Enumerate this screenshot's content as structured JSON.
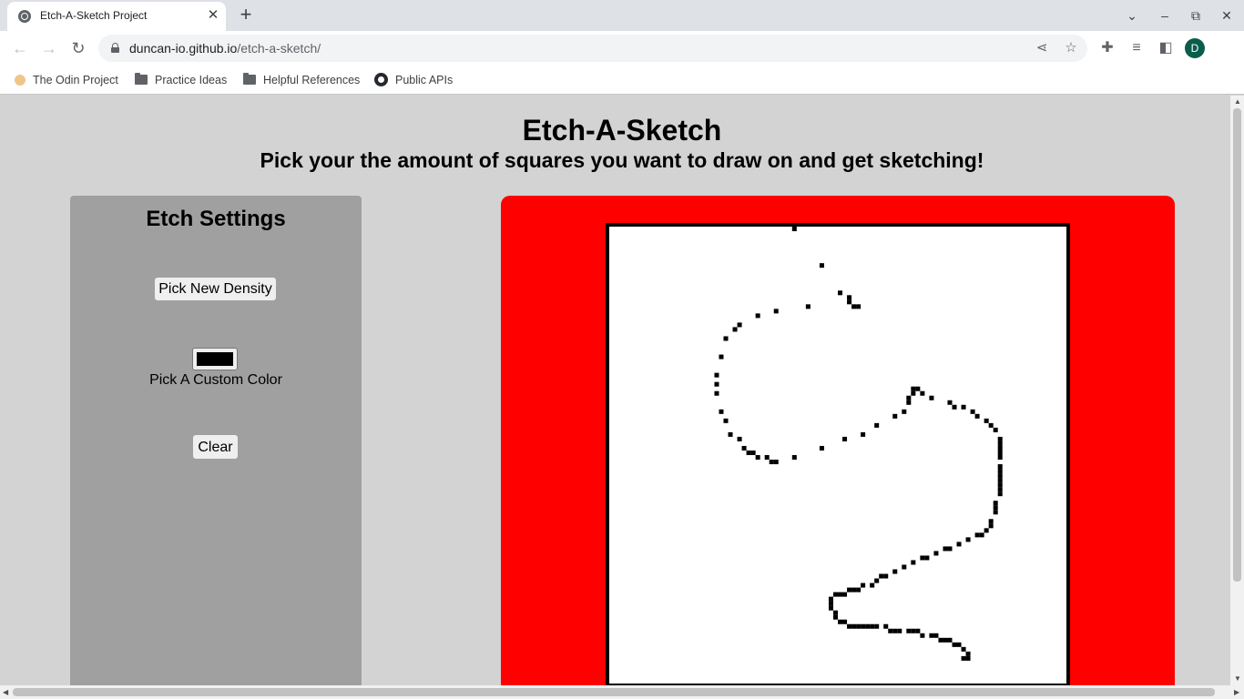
{
  "browser": {
    "tab_title": "Etch-A-Sketch Project",
    "url_host": "duncan-io.github.io",
    "url_path": "/etch-a-sketch/",
    "profile_initial": "D",
    "bookmarks": [
      {
        "label": "The Odin Project",
        "icon": "odin-icon"
      },
      {
        "label": "Practice Ideas",
        "icon": "folder-icon"
      },
      {
        "label": "Helpful References",
        "icon": "folder-icon"
      },
      {
        "label": "Public APIs",
        "icon": "github-icon"
      }
    ]
  },
  "page": {
    "title": "Etch-A-Sketch",
    "subtitle": "Pick your the amount of squares you want to draw on and get sketching!"
  },
  "settings": {
    "title": "Etch Settings",
    "density_button": "Pick New Density",
    "color_label": "Pick A Custom Color",
    "clear_button": "Clear"
  },
  "colors": {
    "board": "#ff0000",
    "canvas": "#ffffff",
    "ink": "#000000",
    "panel": "#a0a0a0",
    "page_bg": "#d3d3d3"
  },
  "sketch": {
    "grid_size": 100,
    "filled_cells": [
      [
        40,
        0
      ],
      [
        46,
        8
      ],
      [
        50,
        14
      ],
      [
        52,
        15
      ],
      [
        52,
        16
      ],
      [
        53,
        17
      ],
      [
        54,
        17
      ],
      [
        43,
        17
      ],
      [
        36,
        18
      ],
      [
        32,
        19
      ],
      [
        28,
        21
      ],
      [
        27,
        22
      ],
      [
        25,
        24
      ],
      [
        24,
        28
      ],
      [
        23,
        32
      ],
      [
        23,
        34
      ],
      [
        23,
        36
      ],
      [
        24,
        40
      ],
      [
        25,
        42
      ],
      [
        26,
        45
      ],
      [
        28,
        46
      ],
      [
        29,
        48
      ],
      [
        30,
        49
      ],
      [
        31,
        49
      ],
      [
        32,
        50
      ],
      [
        34,
        50
      ],
      [
        35,
        51
      ],
      [
        36,
        51
      ],
      [
        40,
        50
      ],
      [
        46,
        48
      ],
      [
        51,
        46
      ],
      [
        55,
        45
      ],
      [
        58,
        43
      ],
      [
        62,
        41
      ],
      [
        64,
        40
      ],
      [
        65,
        38
      ],
      [
        65,
        37
      ],
      [
        66,
        36
      ],
      [
        66,
        35
      ],
      [
        67,
        35
      ],
      [
        68,
        36
      ],
      [
        70,
        37
      ],
      [
        74,
        38
      ],
      [
        75,
        39
      ],
      [
        77,
        39
      ],
      [
        79,
        40
      ],
      [
        80,
        41
      ],
      [
        82,
        42
      ],
      [
        83,
        43
      ],
      [
        84,
        44
      ],
      [
        85,
        46
      ],
      [
        85,
        47
      ],
      [
        85,
        48
      ],
      [
        85,
        49
      ],
      [
        85,
        50
      ],
      [
        85,
        52
      ],
      [
        85,
        53
      ],
      [
        85,
        54
      ],
      [
        85,
        55
      ],
      [
        85,
        56
      ],
      [
        85,
        57
      ],
      [
        85,
        58
      ],
      [
        84,
        60
      ],
      [
        84,
        61
      ],
      [
        84,
        62
      ],
      [
        83,
        64
      ],
      [
        83,
        65
      ],
      [
        82,
        66
      ],
      [
        81,
        67
      ],
      [
        80,
        67
      ],
      [
        78,
        68
      ],
      [
        76,
        69
      ],
      [
        74,
        70
      ],
      [
        73,
        70
      ],
      [
        71,
        71
      ],
      [
        69,
        72
      ],
      [
        68,
        72
      ],
      [
        66,
        73
      ],
      [
        64,
        74
      ],
      [
        62,
        75
      ],
      [
        60,
        76
      ],
      [
        59,
        76
      ],
      [
        58,
        77
      ],
      [
        57,
        78
      ],
      [
        55,
        78
      ],
      [
        54,
        79
      ],
      [
        53,
        79
      ],
      [
        52,
        79
      ],
      [
        51,
        80
      ],
      [
        50,
        80
      ],
      [
        49,
        80
      ],
      [
        48,
        81
      ],
      [
        48,
        82
      ],
      [
        48,
        83
      ],
      [
        49,
        84
      ],
      [
        49,
        85
      ],
      [
        50,
        86
      ],
      [
        51,
        86
      ],
      [
        52,
        87
      ],
      [
        53,
        87
      ],
      [
        54,
        87
      ],
      [
        55,
        87
      ],
      [
        56,
        87
      ],
      [
        57,
        87
      ],
      [
        58,
        87
      ],
      [
        60,
        87
      ],
      [
        61,
        88
      ],
      [
        62,
        88
      ],
      [
        63,
        88
      ],
      [
        65,
        88
      ],
      [
        66,
        88
      ],
      [
        67,
        88
      ],
      [
        68,
        89
      ],
      [
        70,
        89
      ],
      [
        71,
        89
      ],
      [
        72,
        90
      ],
      [
        73,
        90
      ],
      [
        74,
        90
      ],
      [
        75,
        91
      ],
      [
        76,
        91
      ],
      [
        77,
        92
      ],
      [
        78,
        93
      ],
      [
        78,
        94
      ],
      [
        77,
        94
      ]
    ]
  }
}
